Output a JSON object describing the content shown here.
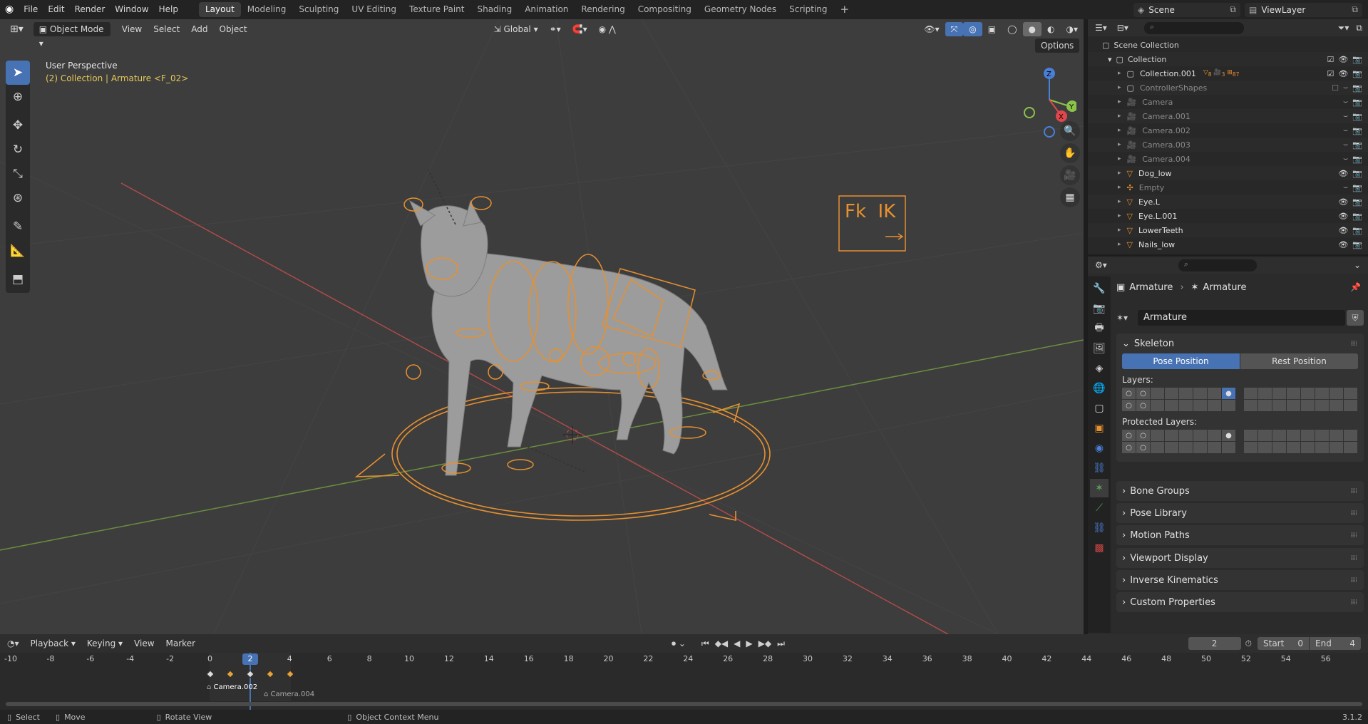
{
  "top_menu": [
    "File",
    "Edit",
    "Render",
    "Window",
    "Help"
  ],
  "workspaces": [
    "Layout",
    "Modeling",
    "Sculpting",
    "UV Editing",
    "Texture Paint",
    "Shading",
    "Animation",
    "Rendering",
    "Compositing",
    "Geometry Nodes",
    "Scripting"
  ],
  "workspace_add": "+",
  "scene": {
    "label": "Scene",
    "view_layer": "ViewLayer"
  },
  "viewport": {
    "mode": "Object Mode",
    "menus": [
      "View",
      "Select",
      "Add",
      "Object"
    ],
    "transform": "Global",
    "options": "Options",
    "overlay_title": "User Perspective",
    "overlay_subtitle": "(2) Collection | Armature <F_02>",
    "fk_ik": "Fk  IK",
    "gizmo": {
      "x": "X",
      "y": "Y",
      "z": "Z"
    },
    "colors": {
      "bg": "#3d3d3d",
      "armature": "#e7902f",
      "mesh": "#9a9a9a",
      "x_axis": "#d2514f",
      "y_axis": "#7aa04b"
    }
  },
  "outliner": {
    "search_placeholder": "",
    "scene_collection": "Scene Collection",
    "collection": "Collection",
    "rows": [
      {
        "name": "Collection.001",
        "type": "collection",
        "counts": [
          "8",
          "3",
          "87"
        ],
        "visible": true
      },
      {
        "name": "ControllerShapes",
        "type": "collection",
        "visible": false
      },
      {
        "name": "Camera",
        "type": "camera",
        "visible": false
      },
      {
        "name": "Camera.001",
        "type": "camera",
        "visible": false
      },
      {
        "name": "Camera.002",
        "type": "camera",
        "visible": false
      },
      {
        "name": "Camera.003",
        "type": "camera",
        "visible": false
      },
      {
        "name": "Camera.004",
        "type": "camera",
        "visible": false
      },
      {
        "name": "Dog_low",
        "type": "mesh",
        "visible": true
      },
      {
        "name": "Empty",
        "type": "empty",
        "visible": false
      },
      {
        "name": "Eye.L",
        "type": "mesh",
        "visible": true
      },
      {
        "name": "Eye.L.001",
        "type": "mesh",
        "visible": true
      },
      {
        "name": "LowerTeeth",
        "type": "mesh",
        "visible": true
      },
      {
        "name": "Nails_low",
        "type": "mesh",
        "visible": true
      }
    ]
  },
  "properties": {
    "breadcrumb_obj": "Armature",
    "breadcrumb_data": "Armature",
    "datablock": "Armature",
    "skeleton": "Skeleton",
    "pose_position": "Pose Position",
    "rest_position": "Rest Position",
    "layers_label": "Layers:",
    "protected_label": "Protected Layers:",
    "panels": [
      "Bone Groups",
      "Pose Library",
      "Motion Paths",
      "Viewport Display",
      "Inverse Kinematics",
      "Custom Properties"
    ]
  },
  "timeline": {
    "menus": [
      "Playback",
      "Keying",
      "View",
      "Marker"
    ],
    "current_frame": "2",
    "start_label": "Start",
    "start": "0",
    "end_label": "End",
    "end": "4",
    "ticks": [
      "-10",
      "-8",
      "-6",
      "-4",
      "-2",
      "0",
      "2",
      "4",
      "6",
      "8",
      "10",
      "12",
      "14",
      "16",
      "18",
      "20",
      "22",
      "24",
      "26",
      "28",
      "30",
      "32",
      "34",
      "36",
      "38",
      "40",
      "42",
      "44",
      "46",
      "48",
      "50",
      "52",
      "54",
      "56"
    ],
    "markers": [
      "Camera.002",
      "Camera.004"
    ]
  },
  "status": {
    "select": "Select",
    "move": "Move",
    "rotate": "Rotate View",
    "context": "Object Context Menu",
    "version": "3.1.2"
  }
}
